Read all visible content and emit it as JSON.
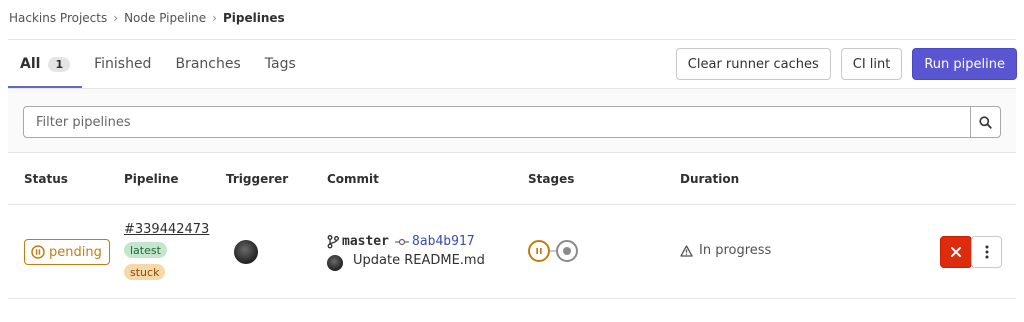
{
  "breadcrumb": {
    "items": [
      "Hackins Projects",
      "Node Pipeline",
      "Pipelines"
    ],
    "separator": "›"
  },
  "tabs": [
    {
      "label": "All",
      "count": "1",
      "active": true
    },
    {
      "label": "Finished"
    },
    {
      "label": "Branches"
    },
    {
      "label": "Tags"
    }
  ],
  "actions": {
    "clear_caches": "Clear runner caches",
    "ci_lint": "CI lint",
    "run_pipeline": "Run pipeline"
  },
  "filter": {
    "placeholder": "Filter pipelines",
    "search_icon": "search-icon"
  },
  "table": {
    "headers": {
      "status": "Status",
      "pipeline": "Pipeline",
      "triggerer": "Triggerer",
      "commit": "Commit",
      "stages": "Stages",
      "duration": "Duration"
    },
    "rows": [
      {
        "status": "pending",
        "pipeline_id": "#339442473",
        "tags": [
          "latest",
          "stuck"
        ],
        "branch": "master",
        "sha": "8ab4b917",
        "commit_title": "Update README.md",
        "stages": [
          "pending",
          "created"
        ],
        "duration": "In progress"
      }
    ]
  },
  "colors": {
    "primary": "#5a55d0",
    "pending": "#c17d10",
    "danger": "#dd2b0e",
    "tab_active": "#6666c4",
    "link": "#3a4bb8"
  }
}
